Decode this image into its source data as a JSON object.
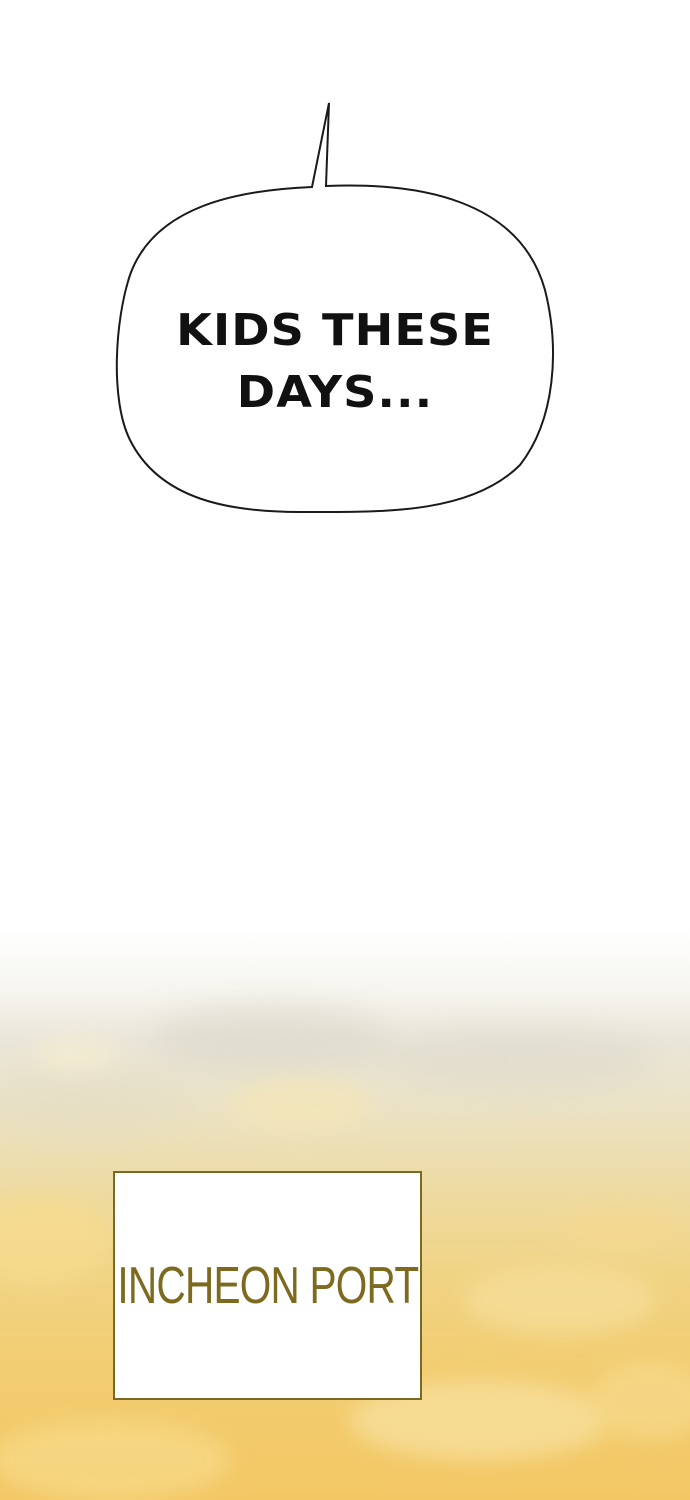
{
  "speech_bubble": {
    "lines": [
      "KIDS THESE",
      "DAYS..."
    ]
  },
  "caption": {
    "text": "INCHEON PORT"
  },
  "colors": {
    "sky_top": "#ffffff",
    "sky_bottom": "#f3c764",
    "caption_border": "#7a6a24",
    "caption_text": "#7d6a1f",
    "bubble_text": "#111111"
  }
}
